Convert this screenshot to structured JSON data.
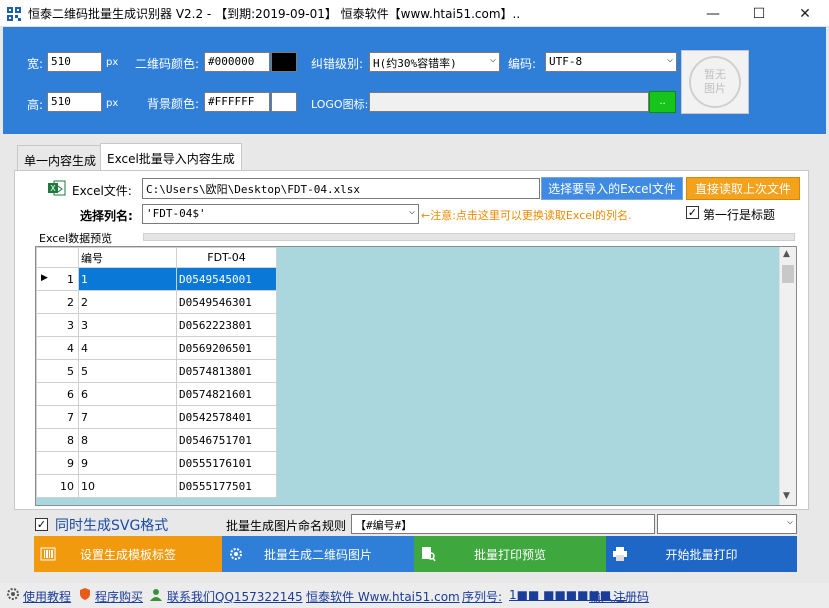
{
  "window": {
    "title": "恒泰二维码批量生成识别器 V2.2 - 【到期:2019-09-01】 恒泰软件【www.htai51.com】..",
    "minimize_glyph": "—",
    "maximize_glyph": "☐",
    "close_glyph": "✕"
  },
  "settings": {
    "width_label": "宽:",
    "width_value": "510",
    "width_unit": "px",
    "height_label": "高:",
    "height_value": "510",
    "height_unit": "px",
    "qr_color_label": "二维码颜色:",
    "qr_color_value": "#000000",
    "qr_color_swatch": "#000000",
    "bg_color_label": "背景颜色:",
    "bg_color_value": "#FFFFFF",
    "bg_color_swatch": "#FFFFFF",
    "ecc_label": "纠错级别:",
    "ecc_value": "H(约30%容错率)",
    "encoding_label": "编码:",
    "encoding_value": "UTF-8",
    "logo_label": "LOGO图标:",
    "logo_value": "",
    "logo_browse_label": "..",
    "no_image_text_line1": "暂无",
    "no_image_text_line2": "图片"
  },
  "tabs": [
    {
      "label": "单一内容生成",
      "active": false
    },
    {
      "label": "Excel批量导入内容生成",
      "active": true
    }
  ],
  "excel": {
    "file_label": "Excel文件:",
    "file_path": "C:\\Users\\欧阳\\Desktop\\FDT-04.xlsx",
    "select_button": "选择要导入的Excel文件",
    "reload_button": "直接读取上次文件",
    "column_label": "选择列名:",
    "column_value": "'FDT-04$'",
    "hint": "←注意:点击这里可以更换读取Excel的列名.",
    "first_row_header_label": "第一行是标题",
    "first_row_header_checked": true,
    "preview_label": "Excel数据预览"
  },
  "grid": {
    "columns": [
      "编号",
      "FDT-04"
    ],
    "rows": [
      {
        "n": "1",
        "a": "1",
        "b": "D0549545001"
      },
      {
        "n": "2",
        "a": "2",
        "b": "D0549546301"
      },
      {
        "n": "3",
        "a": "3",
        "b": "D0562223801"
      },
      {
        "n": "4",
        "a": "4",
        "b": "D0569206501"
      },
      {
        "n": "5",
        "a": "5",
        "b": "D0574813801"
      },
      {
        "n": "6",
        "a": "6",
        "b": "D0574821601"
      },
      {
        "n": "7",
        "a": "7",
        "b": "D0542578401"
      },
      {
        "n": "8",
        "a": "8",
        "b": "D0546751701"
      },
      {
        "n": "9",
        "a": "9",
        "b": "D0555176101"
      },
      {
        "n": "10",
        "a": "10",
        "b": "D0555177501"
      }
    ],
    "selected_row_index": 0
  },
  "options": {
    "svg_label": "同时生成SVG格式",
    "svg_checked": true,
    "naming_label": "批量生成图片命名规则",
    "naming_value": "【#编号#】"
  },
  "actions": {
    "template_label": "设置生成模板标签",
    "generate_label": "批量生成二维码图片",
    "preview_label": "批量打印预览",
    "print_label": "开始批量打印",
    "template_color": "#f29a0d",
    "generate_color": "#2f7fd9",
    "preview_color": "#3ea83e",
    "print_color": "#1f67c7"
  },
  "status": {
    "tutorial": "使用教程",
    "purchase": "程序购买",
    "contact": "联系我们QQ157322145",
    "website": "恒泰软件 Www.htai51.com",
    "serial_label": "序列号:",
    "serial_value": "1■■ ■■■■■■ ...",
    "register": "输入注册码"
  }
}
